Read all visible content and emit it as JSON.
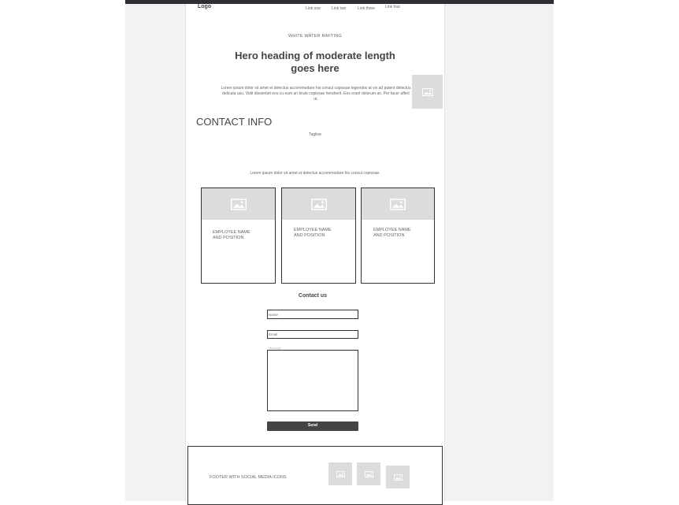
{
  "header": {
    "logo": "Logo",
    "nav": [
      "Link one",
      "Link two",
      "Link three",
      "Link four"
    ]
  },
  "hero": {
    "eyebrow": "WHITE WATER RAFTING",
    "heading": "Hero heading of moderate length goes here",
    "body": "Lorem ipsum dolor sit amet et delectus accommodare his consul copiosae legendos at vix ad putent delectus delicata usu. Vidit dissentiet eos cu eum an brute copiosae hendrerit. Eos erant dolorum an. Per facer affert ut.",
    "image_icon": "image-placeholder-icon"
  },
  "contact_info": {
    "title": "CONTACT INFO",
    "tagline": "Tagline",
    "body": "Lorem ipsum dolor sit amet et delectus accommodare his consul copiosae."
  },
  "team": {
    "cards": [
      {
        "name": "EMPLOYEE NAME AND POSITION",
        "icon": "image-placeholder-icon"
      },
      {
        "name": "EMPLOYEE NAME AND POSITION",
        "icon": "image-placeholder-icon"
      },
      {
        "name": "EMPLOYEE NAME AND POSITION",
        "icon": "image-placeholder-icon"
      }
    ]
  },
  "form": {
    "title": "Contact us",
    "name_placeholder": "Name",
    "email_placeholder": "Email",
    "message_label": "Message",
    "send_label": "Send"
  },
  "footer": {
    "text": "FOOTER WITH SOCIAL MEDIA ICONS",
    "social_icons": [
      "image-placeholder-icon",
      "image-placeholder-icon",
      "image-placeholder-icon"
    ]
  },
  "colors": {
    "topbar": "#2f2f33",
    "canvas": "#f2f2f2",
    "placeholder": "#dcdcdc",
    "button": "#444444"
  }
}
